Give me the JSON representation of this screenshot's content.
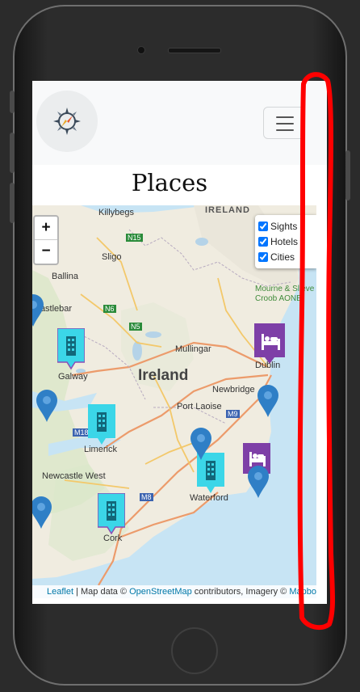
{
  "page": {
    "title": "Places",
    "menu_toggle_label": "Toggle navigation"
  },
  "map": {
    "zoom_in": "+",
    "zoom_out": "−",
    "layers": [
      {
        "label": "Sights",
        "checked": true
      },
      {
        "label": "Hotels",
        "checked": true
      },
      {
        "label": "Cities",
        "checked": true
      }
    ],
    "labels": {
      "country": "Ireland",
      "northern": "IRELAND",
      "cities": [
        "Killybegs",
        "Sligo",
        "Ballina",
        "Castlebar",
        "Galway",
        "Mullingar",
        "Dublin",
        "Newbridge",
        "Port Laoise",
        "Limerick",
        "Newcastle West",
        "Waterford",
        "Cork",
        "Mourne & Slieve Croob AONB"
      ],
      "roads": [
        "N15",
        "N5",
        "N6",
        "M18",
        "M9",
        "M8"
      ]
    },
    "attribution": {
      "leaflet": "Leaflet",
      "text1": " | Map data © ",
      "osm": "OpenStreetMap",
      "text2": " contributors, Imagery © ",
      "mapbox": "Mapbox"
    }
  },
  "colors": {
    "hotel_marker": "#7e3fa7",
    "city_marker": "#3bd6e8",
    "sight_marker": "#2f7fc6",
    "annotation": "#ff0000"
  }
}
